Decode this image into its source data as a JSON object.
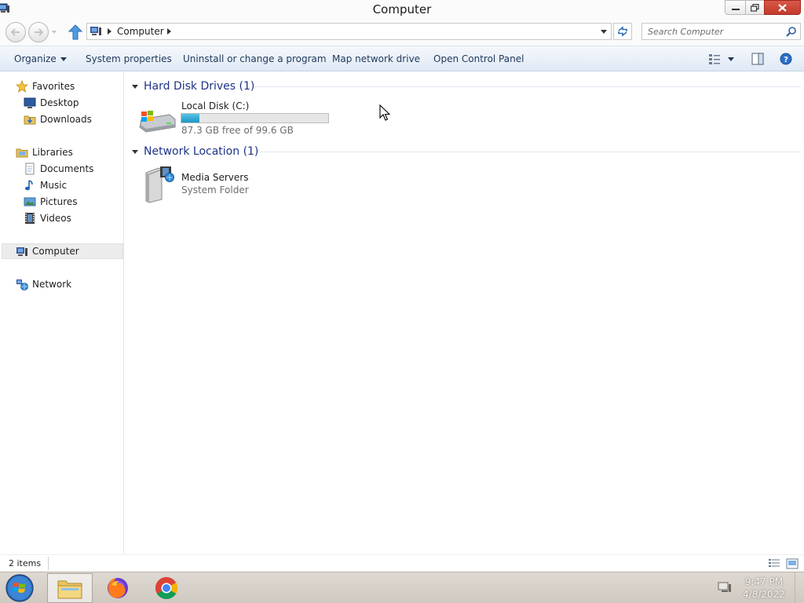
{
  "window": {
    "title": "Computer",
    "controls": {
      "minimize": "minimize",
      "maximize": "restore",
      "close": "close"
    }
  },
  "address": {
    "path": [
      "Computer"
    ],
    "search_placeholder": "Search Computer"
  },
  "commands": {
    "organize": "Organize",
    "system_properties": "System properties",
    "uninstall": "Uninstall or change a program",
    "map_drive": "Map network drive",
    "control_panel": "Open Control Panel"
  },
  "sidebar": {
    "favorites": {
      "label": "Favorites",
      "items": [
        {
          "label": "Desktop",
          "icon": "desktop-icon"
        },
        {
          "label": "Downloads",
          "icon": "downloads-folder-icon"
        }
      ]
    },
    "libraries": {
      "label": "Libraries",
      "items": [
        {
          "label": "Documents",
          "icon": "documents-icon"
        },
        {
          "label": "Music",
          "icon": "music-icon"
        },
        {
          "label": "Pictures",
          "icon": "pictures-icon"
        },
        {
          "label": "Videos",
          "icon": "videos-icon"
        }
      ]
    },
    "computer": {
      "label": "Computer",
      "selected": true
    },
    "network": {
      "label": "Network"
    }
  },
  "content": {
    "groups": [
      {
        "title": "Hard Disk Drives (1)",
        "items": [
          {
            "name": "Local Disk (C:)",
            "free_text": "87.3 GB free of 99.6 GB",
            "used_fraction": 0.123,
            "icon": "hard-drive-icon"
          }
        ]
      },
      {
        "title": "Network Location (1)",
        "items": [
          {
            "name": "Media Servers",
            "subtitle": "System Folder",
            "icon": "media-server-icon"
          }
        ]
      }
    ]
  },
  "status": {
    "item_count": "2 items"
  },
  "taskbar": {
    "apps": [
      {
        "name": "File Explorer",
        "icon": "file-explorer-icon",
        "active": true
      },
      {
        "name": "Firefox",
        "icon": "firefox-icon",
        "active": false
      },
      {
        "name": "Chrome",
        "icon": "chrome-icon",
        "active": false
      }
    ],
    "clock": {
      "time": "9:47 PM",
      "date": "4/8/2022"
    }
  },
  "colors": {
    "accent_link": "#1e3287",
    "command_text": "#1e395b",
    "close_button": "#c94536",
    "capacity_fill": "#26a0d1"
  }
}
